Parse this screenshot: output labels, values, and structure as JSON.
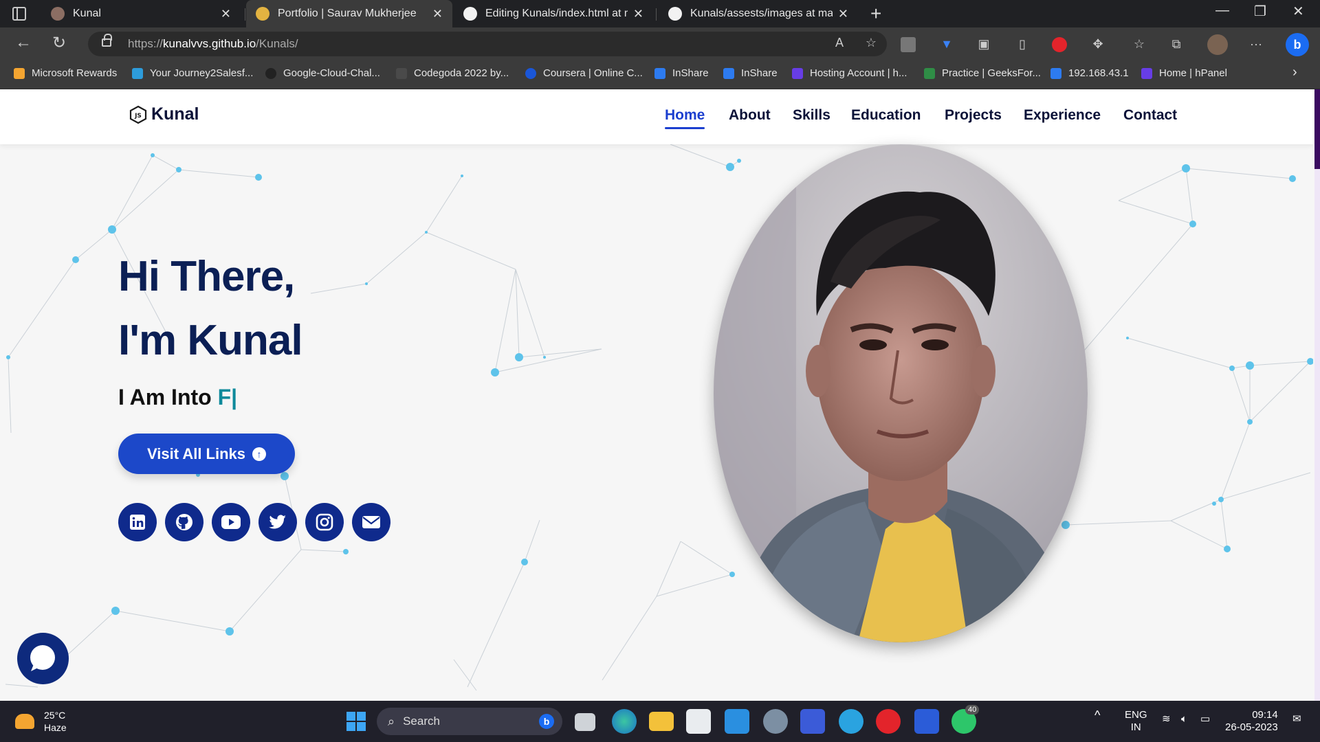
{
  "browser": {
    "tabs": [
      {
        "label": "Kunal",
        "active": false
      },
      {
        "label": "Portfolio | Saurav Mukherjee",
        "active": true
      },
      {
        "label": "Editing Kunals/index.html at main",
        "active": false
      },
      {
        "label": "Kunals/assests/images at main · K",
        "active": false
      }
    ],
    "url_scheme": "https://",
    "url_host": "kunalvvs.github.io",
    "url_path": "/Kunals/",
    "bookmarks": [
      {
        "label": "Microsoft Rewards",
        "color": "#f4a531"
      },
      {
        "label": "Your Journey2Salesf...",
        "color": "#2d9cdb"
      },
      {
        "label": "Google-Cloud-Chal...",
        "color": "#222222"
      },
      {
        "label": "Codegoda 2022 by...",
        "color": "#4a4a4a"
      },
      {
        "label": "Coursera | Online C...",
        "color": "#1a56d8"
      },
      {
        "label": "InShare",
        "color": "#2d7bf0"
      },
      {
        "label": "InShare",
        "color": "#2d7bf0"
      },
      {
        "label": "Hosting Account | h...",
        "color": "#673de6"
      },
      {
        "label": "Practice | GeeksFor...",
        "color": "#2f8d46"
      },
      {
        "label": "192.168.43.1",
        "color": "#2d7bf0"
      },
      {
        "label": "Home | hPanel",
        "color": "#673de6"
      }
    ]
  },
  "site": {
    "logo_text": "Kunal",
    "nav": [
      "Home",
      "About",
      "Skills",
      "Education",
      "Projects",
      "Experience",
      "Contact"
    ],
    "active_nav": "Home",
    "greeting_line1": "Hi There,",
    "greeting_line2": "I'm Kunal",
    "into_prefix": "I Am Into",
    "typed_text": "F|",
    "cta_label": "Visit All Links",
    "socials": [
      "linkedin-icon",
      "github-icon",
      "youtube-icon",
      "twitter-icon",
      "instagram-icon",
      "email-icon"
    ],
    "colors": {
      "accent": "#1c48c9",
      "heading": "#0b1f55",
      "typed": "#0e8a9b",
      "social_bg": "#0f2a8c"
    }
  },
  "taskbar": {
    "temp": "25°C",
    "weather": "Haze",
    "search_placeholder": "Search",
    "whatsapp_badge": "40",
    "lang1": "ENG",
    "lang2": "IN",
    "time": "09:14",
    "date": "26-05-2023"
  }
}
